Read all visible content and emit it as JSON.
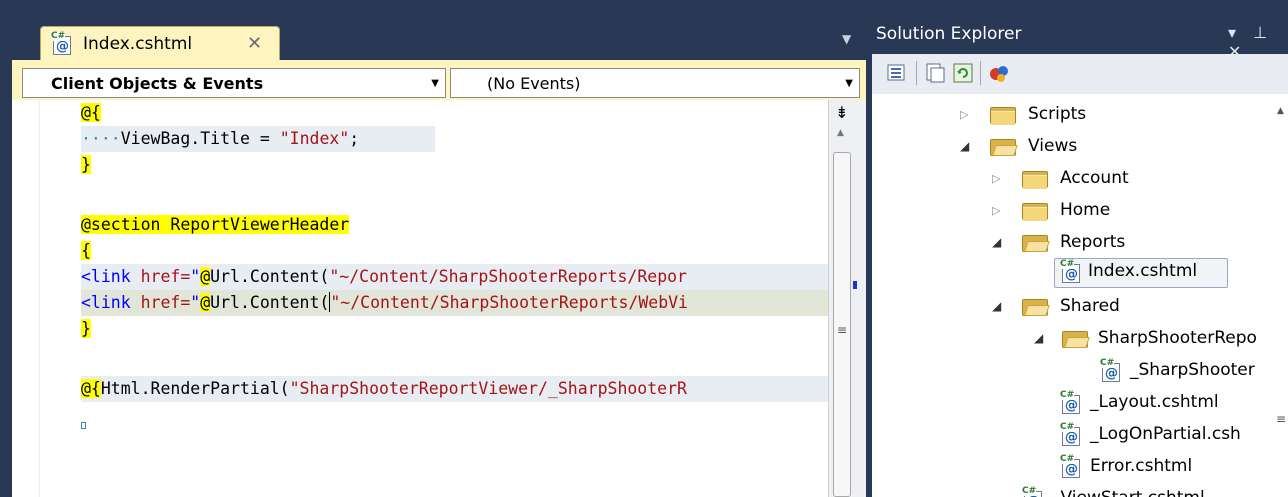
{
  "editor": {
    "tab_label": "Index.cshtml",
    "tab_close": "✕",
    "tab_overflow": "▼",
    "objects_combo": "Client Objects & Events",
    "events_combo": "(No Events)",
    "lines": {
      "l1": "@{",
      "l2_ws": "····",
      "l2_a": "ViewBag.Title",
      "l2_b": " = ",
      "l2_c": "\"Index\"",
      "l2_d": ";",
      "l3": "}",
      "l5_kw": "@section",
      "l5_name": " ReportViewerHeader",
      "l6": "{",
      "l7_tag": "<link",
      "l7_attr": " href=",
      "l7_q": "\"",
      "l7_at": "@",
      "l7_call": "Url.Content(",
      "l7_str": "\"~/Content/SharpShooterReports/Repor",
      "l8_tag": "<link",
      "l8_attr": " href=",
      "l8_q": "\"",
      "l8_at": "@",
      "l8_call": "Url.Content(",
      "l8_str": "\"~/Content/SharpShooterReports/WebVi",
      "l9": "}",
      "l11_at": "@{",
      "l11_call": "Html.RenderPartial(",
      "l11_str": "\"SharpShooterReportViewer/_SharpShooterR"
    }
  },
  "solution_explorer": {
    "title": "Solution Explorer",
    "title_buttons": "▾ ⊥ ✕",
    "tree": [
      {
        "label": "Scripts",
        "icon": "folder-icon",
        "expanded": false
      },
      {
        "label": "Views",
        "icon": "folder-open-icon",
        "expanded": true
      },
      {
        "label": "Account",
        "icon": "folder-icon",
        "expanded": false
      },
      {
        "label": "Home",
        "icon": "folder-icon",
        "expanded": false
      },
      {
        "label": "Reports",
        "icon": "folder-open-icon",
        "expanded": true
      },
      {
        "label": "Index.cshtml",
        "icon": "cshtml-file-icon",
        "selected": true
      },
      {
        "label": "Shared",
        "icon": "folder-open-icon",
        "expanded": true
      },
      {
        "label": "SharpShooterRepo",
        "icon": "folder-open-icon",
        "expanded": true
      },
      {
        "label": "_SharpShooter",
        "icon": "cshtml-file-icon"
      },
      {
        "label": "_Layout.cshtml",
        "icon": "cshtml-file-icon"
      },
      {
        "label": "_LogOnPartial.csh",
        "icon": "cshtml-file-icon"
      },
      {
        "label": "Error.cshtml",
        "icon": "cshtml-file-icon"
      },
      {
        "label": "_ViewStart.cshtml",
        "icon": "cshtml-file-icon"
      }
    ]
  }
}
